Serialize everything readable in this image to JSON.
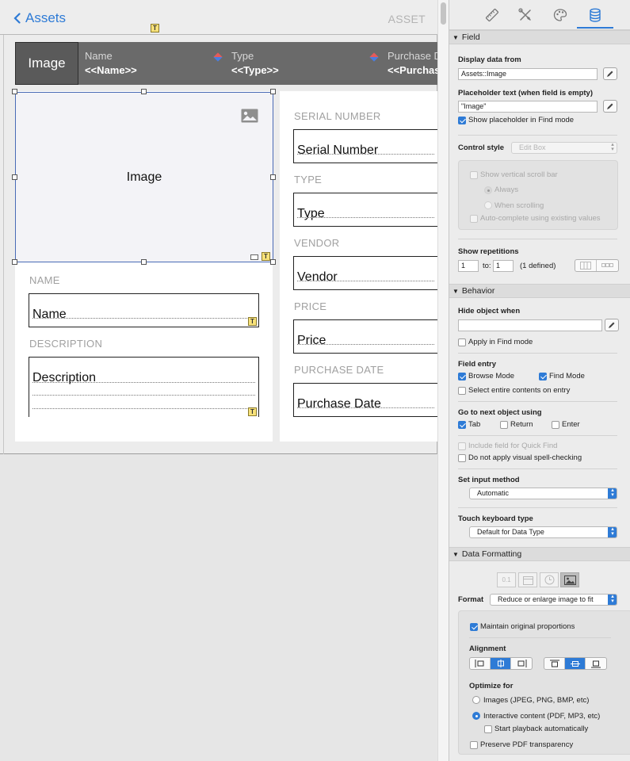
{
  "nav": {
    "back_label": "Assets",
    "title": "ASSET"
  },
  "header": {
    "image_label": "Image",
    "columns": [
      {
        "label": "Name",
        "value": "<<Name>>"
      },
      {
        "label": "Type",
        "value": "<<Type>>"
      },
      {
        "label": "Purchase Date",
        "value": "<<Purchase Date>>"
      }
    ]
  },
  "image_field": {
    "label": "Image"
  },
  "left_fields": [
    {
      "label": "NAME",
      "value": "Name"
    },
    {
      "label": "DESCRIPTION",
      "value": "Description"
    }
  ],
  "right_fields": [
    {
      "label": "SERIAL NUMBER",
      "value": "Serial Number"
    },
    {
      "label": "TYPE",
      "value": "Type"
    },
    {
      "label": "VENDOR",
      "value": "Vendor"
    },
    {
      "label": "PRICE",
      "value": "Price"
    },
    {
      "label": "PURCHASE DATE",
      "value": "Purchase Date"
    }
  ],
  "inspector": {
    "tabs": [
      {
        "name": "position",
        "icon": "ruler-icon"
      },
      {
        "name": "appearance-tools",
        "icon": "tools-icon"
      },
      {
        "name": "appearance",
        "icon": "palette-icon"
      },
      {
        "name": "data",
        "icon": "database-icon",
        "active": true
      }
    ],
    "field_section": {
      "title": "Field",
      "display_data_from_label": "Display data from",
      "display_data_from_value": "Assets::Image",
      "placeholder_label": "Placeholder text (when field is empty)",
      "placeholder_value": "\"Image\"",
      "show_placeholder_find": "Show placeholder in Find mode",
      "control_style_label": "Control style",
      "control_style_value": "Edit Box",
      "show_vscroll": "Show vertical scroll bar",
      "always": "Always",
      "when_scrolling": "When scrolling",
      "autocomplete": "Auto-complete using existing values",
      "show_repetitions_label": "Show repetitions",
      "rep_from": "1",
      "rep_to_label": "to:",
      "rep_to": "1",
      "rep_defined": "(1 defined)"
    },
    "behavior_section": {
      "title": "Behavior",
      "hide_object_label": "Hide object when",
      "hide_object_value": "",
      "apply_find": "Apply in Find mode",
      "field_entry_label": "Field entry",
      "browse_mode": "Browse Mode",
      "find_mode": "Find Mode",
      "select_entire": "Select entire contents on entry",
      "go_next_label": "Go to next object using",
      "tab": "Tab",
      "return": "Return",
      "enter": "Enter",
      "quick_find": "Include field for Quick Find",
      "spell_check": "Do not apply visual spell-checking",
      "input_method_label": "Set input method",
      "input_method_value": "Automatic",
      "touch_kb_label": "Touch keyboard type",
      "touch_kb_value": "Default for Data Type"
    },
    "data_formatting_section": {
      "title": "Data Formatting",
      "format_label": "Format",
      "format_value": "Reduce or enlarge image to fit",
      "number_icon_label": "0.1",
      "maintain_proportions": "Maintain original proportions",
      "alignment_label": "Alignment",
      "optimize_label": "Optimize for",
      "opt_images": "Images (JPEG, PNG, BMP, etc)",
      "opt_interactive": "Interactive content (PDF, MP3, etc)",
      "start_playback": "Start playback automatically",
      "preserve_pdf": "Preserve PDF transparency"
    }
  },
  "colors": {
    "accent": "#2e7bd6",
    "header_band": "#6a6a6a",
    "handle_border": "#4a6bb6"
  }
}
